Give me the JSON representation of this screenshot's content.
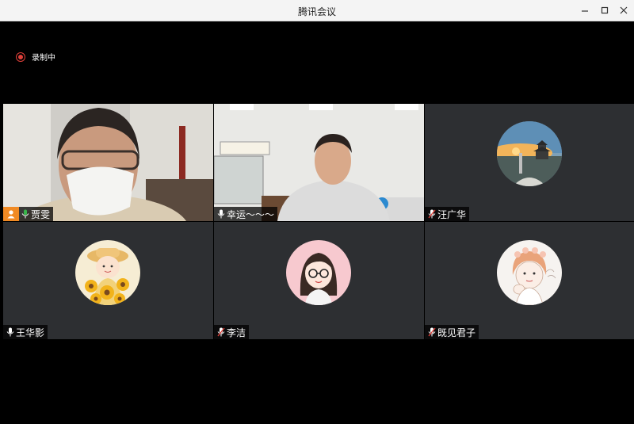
{
  "window": {
    "title": "腾讯会议",
    "buttons": {
      "min": "—",
      "max": "☐",
      "close": "✕"
    }
  },
  "recording": {
    "label": "录制中",
    "color": "#e0403a"
  },
  "participants": [
    {
      "name": "贾雯",
      "type": "video",
      "host": true,
      "speaking": true,
      "mic": "on"
    },
    {
      "name": "幸运～～～",
      "type": "video",
      "host": false,
      "mic": "on"
    },
    {
      "name": "汪广华",
      "type": "avatar",
      "avatar": "sunset-pavilion-avatar",
      "mic": "muted"
    },
    {
      "name": "王华影",
      "type": "avatar",
      "avatar": "sunflower-girl-avatar",
      "mic": "on"
    },
    {
      "name": "李洁",
      "type": "avatar",
      "avatar": "glasses-girl-avatar",
      "mic": "muted"
    },
    {
      "name": "既见君子",
      "type": "avatar",
      "avatar": "sketch-girl-avatar",
      "mic": "muted"
    }
  ],
  "colors": {
    "tile_bg": "#2d2f32",
    "active_border": "#39b54a",
    "host_badge": "#f08a24",
    "mic_on": "#ffffff",
    "mic_muted": "#e0403a"
  }
}
